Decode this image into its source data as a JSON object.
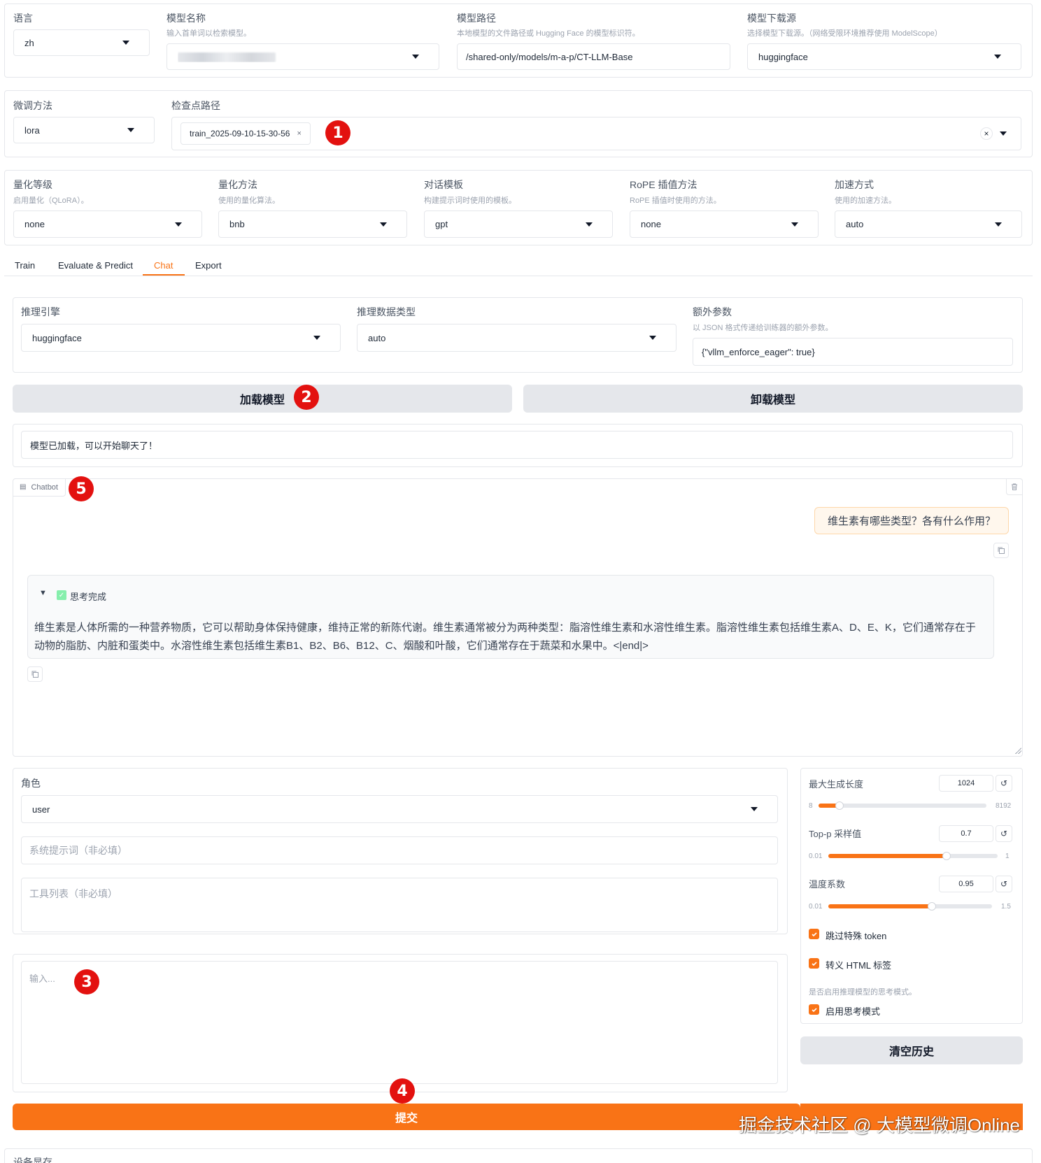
{
  "top": {
    "lang": {
      "label": "语言",
      "value": "zh"
    },
    "model_name": {
      "label": "模型名称",
      "hint": "输入首单词以检索模型。"
    },
    "model_path": {
      "label": "模型路径",
      "hint": "本地模型的文件路径或 Hugging Face 的模型标识符。",
      "value": "/shared-only/models/m-a-p/CT-LLM-Base"
    },
    "hub": {
      "label": "模型下载源",
      "hint": "选择模型下载源。（网络受限环境推荐使用 ModelScope）",
      "value": "huggingface"
    }
  },
  "finetune": {
    "method": {
      "label": "微调方法",
      "value": "lora"
    },
    "checkpoint": {
      "label": "检查点路径",
      "chip": "train_2025-09-10-15-30-56",
      "chip_close": "×",
      "clear": "×"
    }
  },
  "quant": [
    {
      "label": "量化等级",
      "hint": "启用量化（QLoRA）。",
      "value": "none"
    },
    {
      "label": "量化方法",
      "hint": "使用的量化算法。",
      "value": "bnb"
    },
    {
      "label": "对话模板",
      "hint": "构建提示词时使用的模板。",
      "value": "gpt"
    },
    {
      "label": "RoPE 插值方法",
      "hint": "RoPE 插值时使用的方法。",
      "value": "none"
    },
    {
      "label": "加速方式",
      "hint": "使用的加速方法。",
      "value": "auto"
    }
  ],
  "tabs": [
    "Train",
    "Evaluate & Predict",
    "Chat",
    "Export"
  ],
  "infer": {
    "backend": {
      "label": "推理引擎",
      "value": "huggingface"
    },
    "dtype": {
      "label": "推理数据类型",
      "value": "auto"
    },
    "extra": {
      "label": "额外参数",
      "hint": "以 JSON 格式传递给训练器的额外参数。",
      "value": "{\"vllm_enforce_eager\": true}"
    }
  },
  "buttons": {
    "load": "加载模型",
    "unload": "卸载模型",
    "clear": "清空历史",
    "submit": "提交"
  },
  "status": "模型已加载，可以开始聊天了！",
  "chatbot": {
    "label": "Chatbot",
    "user_msg": "维生素有哪些类型？各有什么作用？",
    "think_toggle": "▼",
    "think_title": "思考完成",
    "bot_msg": "维生素是人体所需的一种营养物质，它可以帮助身体保持健康，维持正常的新陈代谢。维生素通常被分为两种类型：脂溶性维生素和水溶性维生素。脂溶性维生素包括维生素A、D、E、K，它们通常存在于动物的脂肪、内脏和蛋类中。水溶性维生素包括维生素B1、B2、B6、B12、C、烟酸和叶酸，它们通常存在于蔬菜和水果中。<|end|>"
  },
  "role": {
    "label": "角色",
    "value": "user"
  },
  "system_prompt": {
    "placeholder": "系统提示词（非必填）"
  },
  "tools": {
    "placeholder": "工具列表（非必填）"
  },
  "input": {
    "placeholder": "输入..."
  },
  "params": {
    "max_new_tokens": {
      "label": "最大生成长度",
      "value": "1024",
      "min": "8",
      "max": "8192",
      "fraction": 0.124
    },
    "top_p": {
      "label": "Top-p 采样值",
      "value": "0.7",
      "min": "0.01",
      "max": "1",
      "fraction": 0.697
    },
    "temperature": {
      "label": "温度系数",
      "value": "0.95",
      "min": "0.01",
      "max": "1.5",
      "fraction": 0.631
    },
    "reset_glyph": "↺"
  },
  "checks": {
    "skip_special": "跳过特殊 token",
    "escape_html": "转义 HTML 标签",
    "thinking_hint": "是否启用推理模型的思考模式。",
    "enable_thinking": "启用思考模式"
  },
  "badges": [
    "1",
    "2",
    "3",
    "4",
    "5"
  ],
  "watermark": "掘金技术社区 @ 大模型微调Online",
  "partial_bottom_label": "设备显存",
  "colors": {
    "accent": "#f97316",
    "badge": "#e3110f",
    "button_gray": "#e5e7eb"
  }
}
